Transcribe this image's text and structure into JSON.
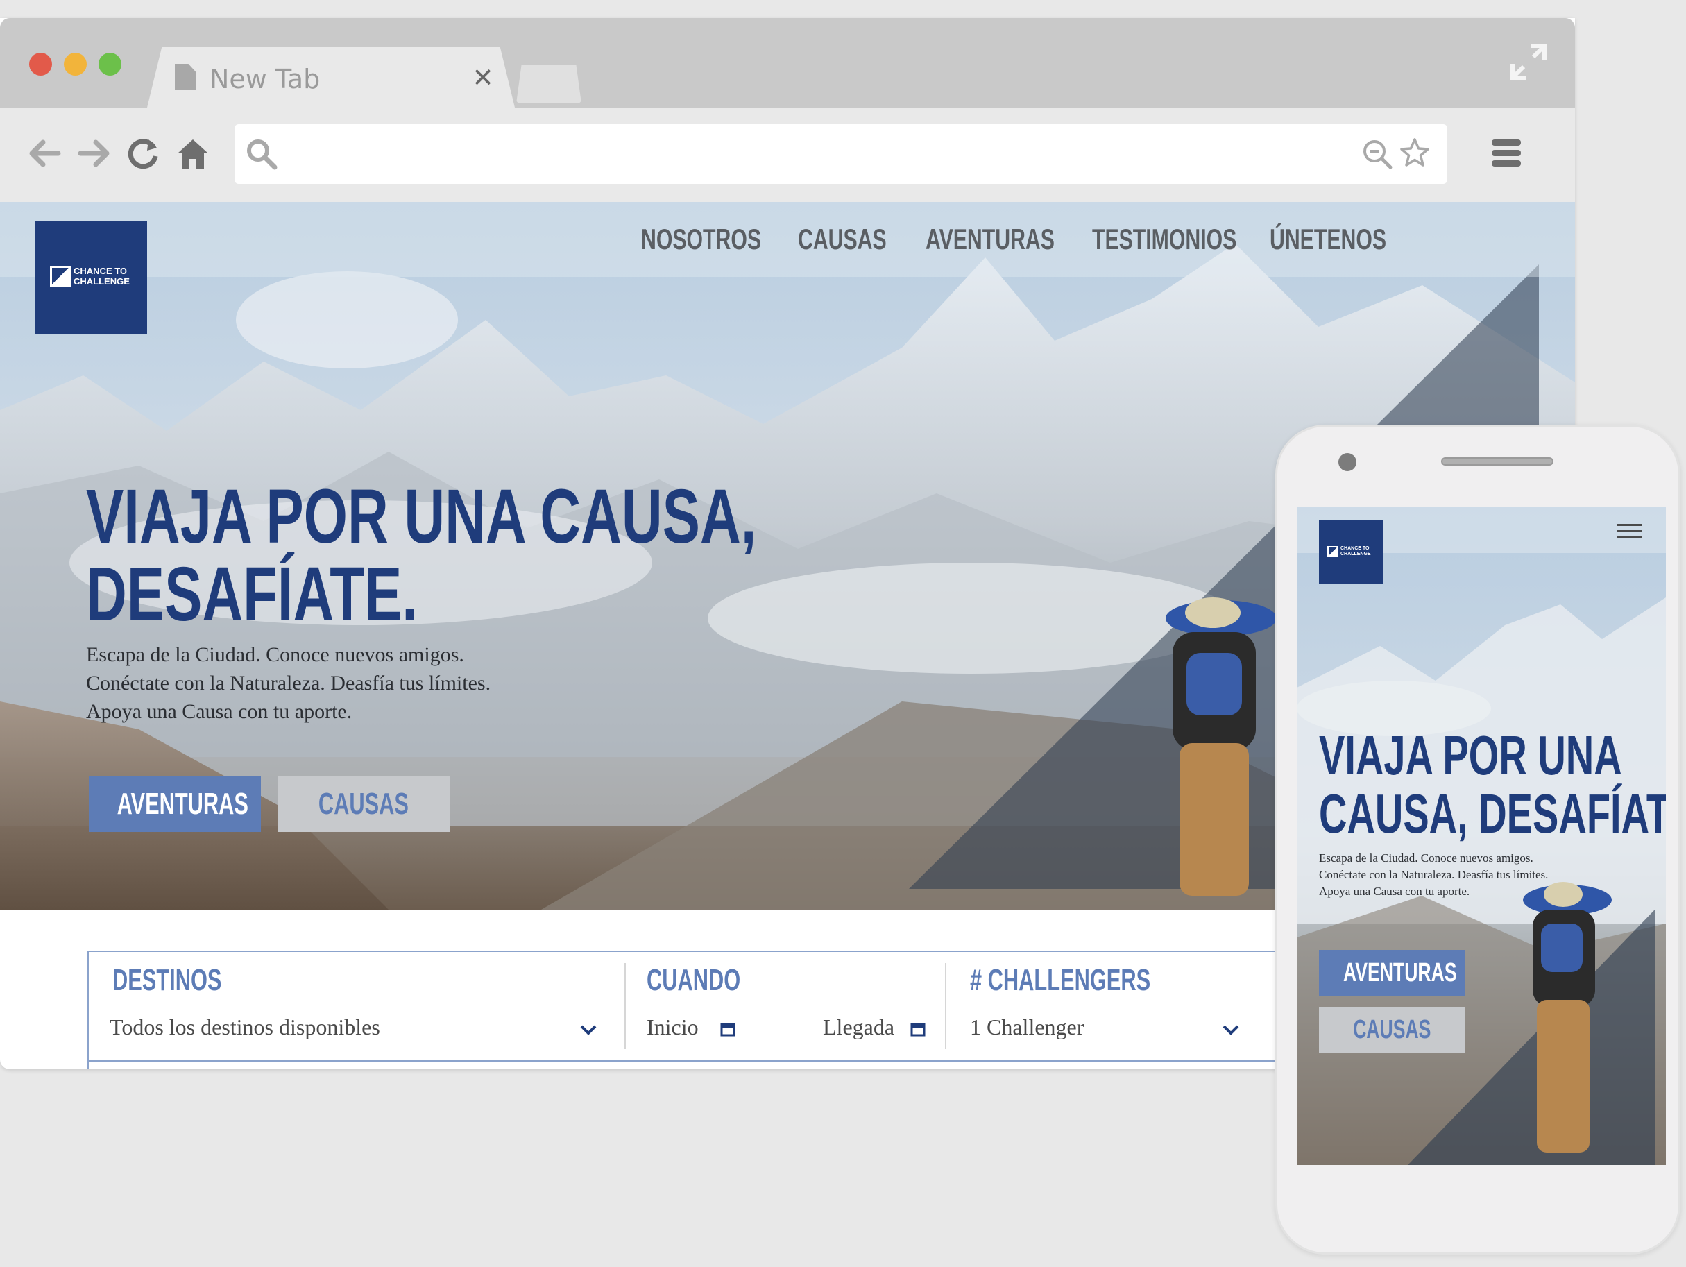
{
  "browser": {
    "tab_title": "New Tab",
    "tab_close": "✕"
  },
  "site": {
    "logo_line1": "CHANCE TO",
    "logo_line2": "CHALLENGE",
    "nav": [
      "NOSOTROS",
      "CAUSAS",
      "AVENTURAS",
      "TESTIMONIOS",
      "ÚNETENOS"
    ],
    "hero_title_line1": "VIAJA POR UNA CAUSA,",
    "hero_title_line2": "DESAFÍATE.",
    "hero_sub": [
      "Escapa de la Ciudad. Conoce nuevos amigos.",
      "Conéctate con la Naturaleza. Deasfía tus límites.",
      "Apoya una Causa con tu aporte."
    ],
    "btn_primary": "AVENTURAS",
    "btn_secondary": "CAUSAS",
    "search": {
      "destinos_label": "DESTINOS",
      "destinos_value": "Todos los destinos disponibles",
      "cuando_label": "CUANDO",
      "inicio": "Inicio",
      "llegada": "Llegada",
      "challengers_label": "# CHALLENGERS",
      "challengers_value": "1 Challenger"
    }
  },
  "mobile": {
    "title_line1": "VIAJA POR UNA",
    "title_line2": "CAUSA, DESAFÍATE.",
    "sub": [
      "Escapa de la Ciudad. Conoce nuevos amigos.",
      "Conéctate con la Naturaleza. Deasfía tus límites.",
      "Apoya una Causa con tu aporte."
    ],
    "btn_primary": "AVENTURAS",
    "btn_secondary": "CAUSAS"
  },
  "colors": {
    "brand_navy": "#1f3c7b",
    "accent_blue": "#5d7cb6",
    "button_grey": "#c7c9cc"
  }
}
